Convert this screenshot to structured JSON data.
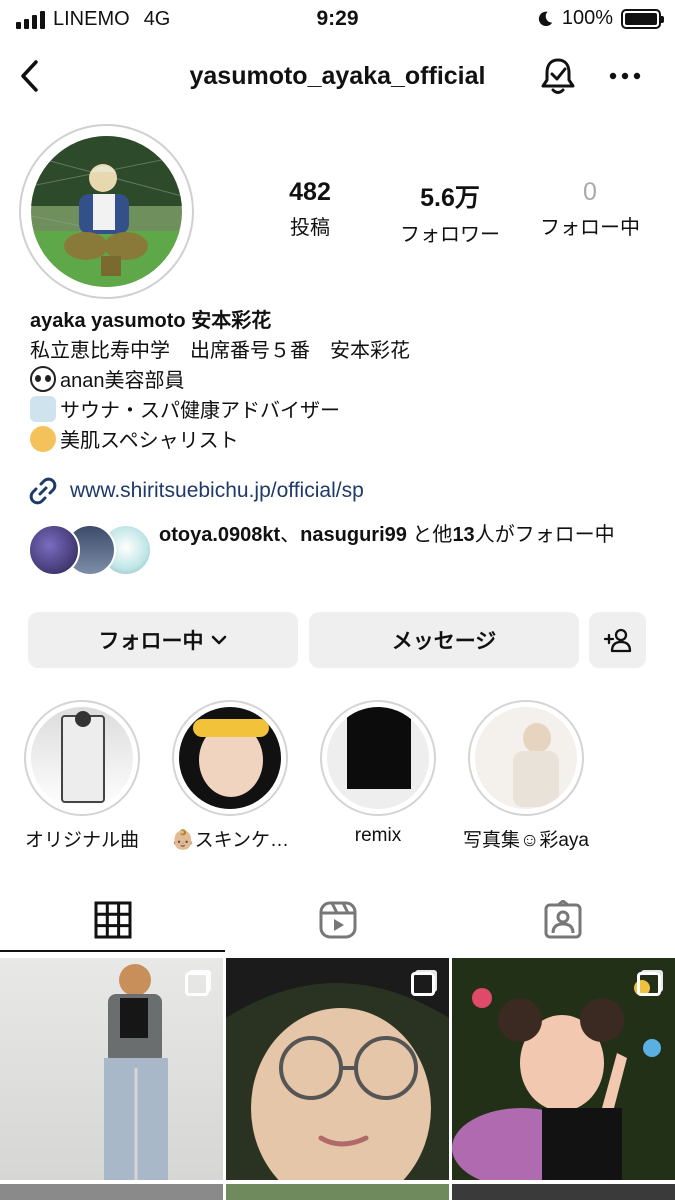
{
  "status_bar": {
    "carrier": "LINEMO",
    "network": "4G",
    "time": "9:29",
    "battery": "100%",
    "battery_level": 1.0,
    "icons": [
      "signal-icon",
      "moon-icon",
      "battery-icon"
    ]
  },
  "header": {
    "username": "yasumoto_ayaka_official",
    "icons": [
      "back-icon",
      "bell-check-icon",
      "more-icon"
    ]
  },
  "stats": [
    {
      "value": "482",
      "label": "投稿"
    },
    {
      "value": "5.6万",
      "label": "フォロワー"
    },
    {
      "value": "0",
      "label": "フォロー中"
    }
  ],
  "bio": {
    "name": "ayaka yasumoto  安本彩花",
    "lines": [
      "私立恵比寿中学　出席番号５番　安本彩花",
      "anan美容部員",
      "サウナ・スパ健康アドバイザー",
      "美肌スペシャリスト"
    ],
    "line_emoji": [
      "panda",
      "man-in-steam",
      "baby"
    ],
    "link": "www.shiritsuebichu.jp/official/sp"
  },
  "followed_by": {
    "user1": "otoya.0908kt",
    "sep": "、",
    "user2": "nasuguri99",
    "mid": " と他",
    "count": "13",
    "unit": "人",
    "tail": "がフォロー中"
  },
  "buttons": {
    "following": "フォロー中",
    "message": "メッセージ"
  },
  "highlights": [
    {
      "label": "オリジナル曲"
    },
    {
      "label": "👶🏼スキンケ…"
    },
    {
      "label": "remix"
    },
    {
      "label": "写真集☺︎彩aya"
    }
  ],
  "tabs": [
    "grid",
    "reels",
    "tagged"
  ],
  "colors": {
    "text": "#111111",
    "muted": "#aaaaaa",
    "link": "#1e3a6a",
    "button_bg": "#efefef"
  }
}
